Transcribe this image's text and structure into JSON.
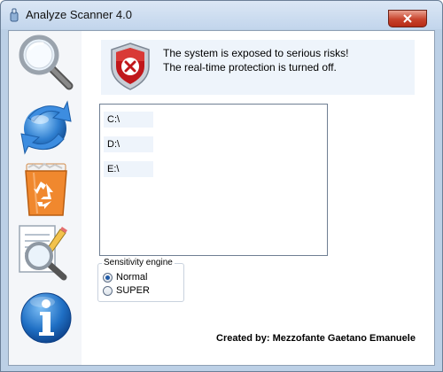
{
  "window": {
    "title": "Analyze Scanner 4.0"
  },
  "sidebar": {
    "items": [
      {
        "name": "search-scan",
        "icon": "magnifier-icon"
      },
      {
        "name": "update",
        "icon": "blue-refresh-orb-icon"
      },
      {
        "name": "recycle-bin",
        "icon": "orange-recycle-bin-icon"
      },
      {
        "name": "report-analysis",
        "icon": "document-magnifier-pencil-icon"
      },
      {
        "name": "information",
        "icon": "info-icon"
      }
    ]
  },
  "status": {
    "line1": "The system is exposed to serious risks!",
    "line2": "The real-time protection is turned off.",
    "shield_color": "#c0161a"
  },
  "drives": [
    "C:\\",
    "D:\\",
    "E:\\"
  ],
  "sensitivity": {
    "label": "Sensitivity engine",
    "options": [
      {
        "label": "Normal",
        "selected": true
      },
      {
        "label": "SUPER",
        "selected": false
      }
    ]
  },
  "footer": {
    "credit": "Created by: Mezzofante Gaetano Emanuele"
  }
}
